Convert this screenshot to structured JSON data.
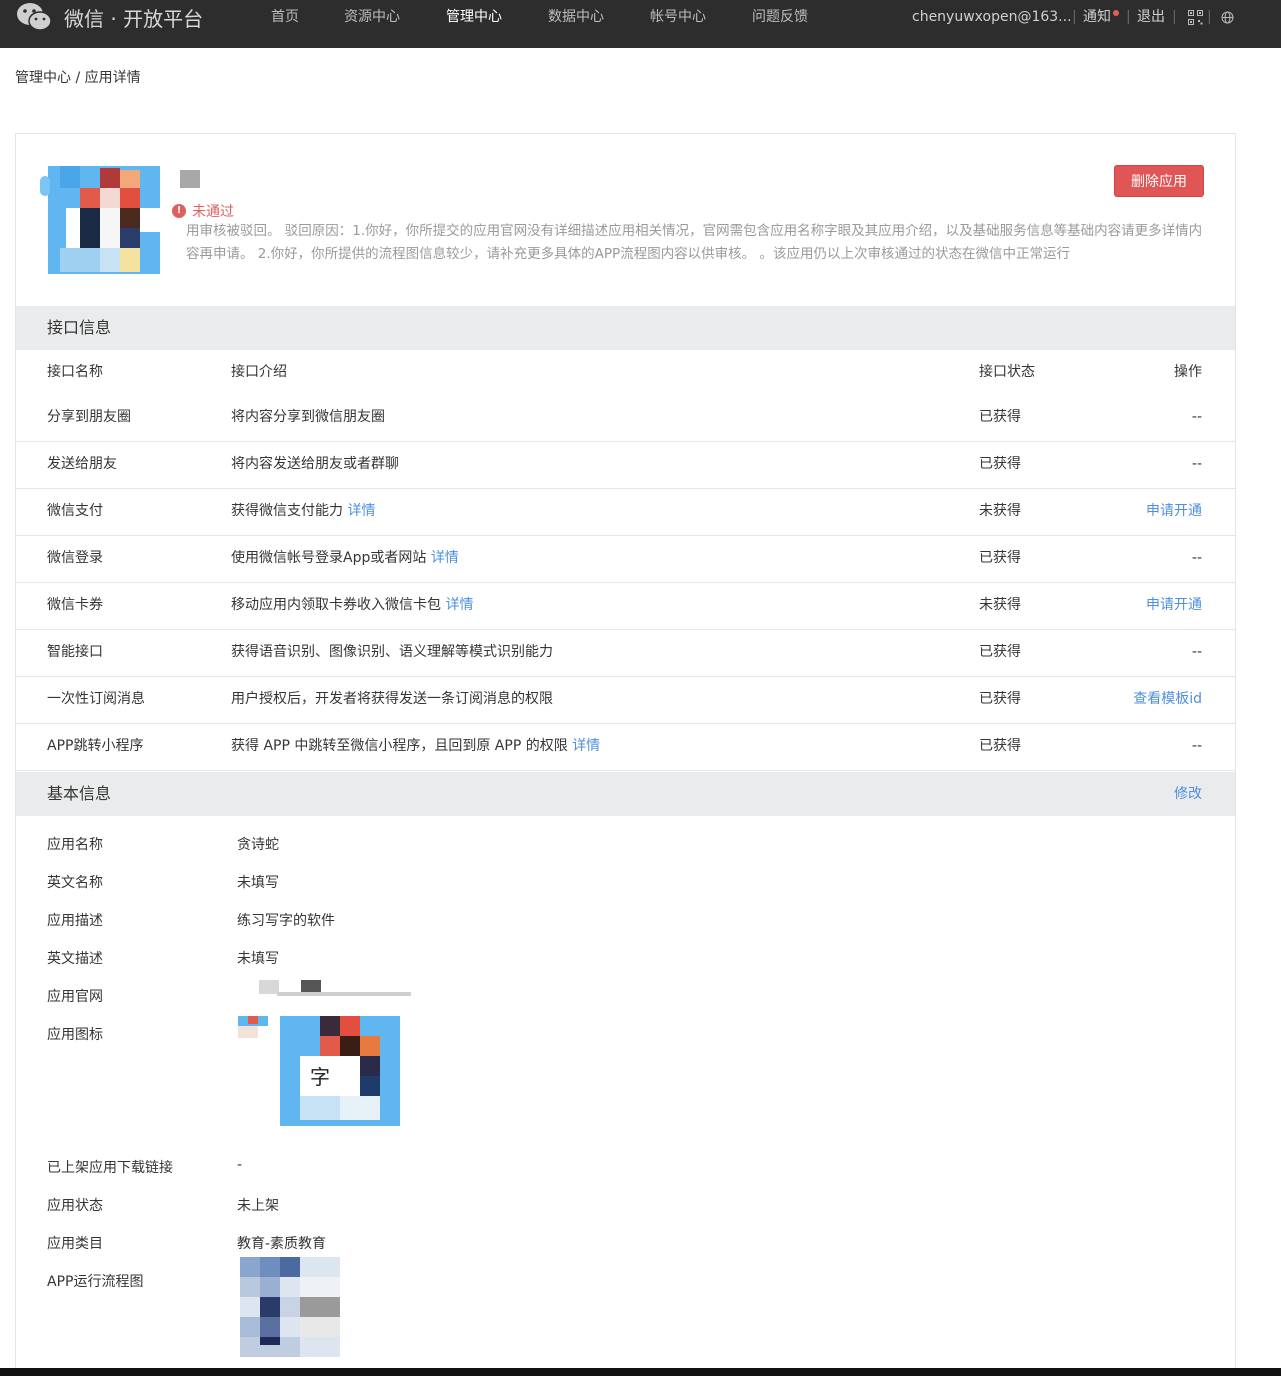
{
  "topbar": {
    "brand": "微信 · 开放平台",
    "nav": [
      "首页",
      "资源中心",
      "管理中心",
      "数据中心",
      "帐号中心",
      "问题反馈"
    ],
    "active_nav": "管理中心",
    "user": "chenyuwxopen@163...",
    "notify": "通知",
    "logout": "退出"
  },
  "breadcrumb": "管理中心 / 应用详情",
  "app": {
    "status": "未通过",
    "reject_reason": "用审核被驳回。 驳回原因：1.你好，你所提交的应用官网没有详细描述应用相关情况，官网需包含应用名称字眼及其应用介绍，以及基础服务信息等基础内容请更多详情内容再申请。 2.你好，你所提供的流程图信息较少，请补充更多具体的APP流程图内容以供审核。 。该应用仍以上次审核通过的状态在微信中正常运行",
    "delete_label": "删除应用"
  },
  "api_section": {
    "title": "接口信息",
    "headers": [
      "接口名称",
      "接口介绍",
      "接口状态",
      "操作"
    ],
    "rows": [
      {
        "name": "分享到朋友圈",
        "desc": "将内容分享到微信朋友圈",
        "link": "",
        "status": "已获得",
        "action": "--",
        "action_link": false
      },
      {
        "name": "发送给朋友",
        "desc": "将内容发送给朋友或者群聊",
        "link": "",
        "status": "已获得",
        "action": "--",
        "action_link": false
      },
      {
        "name": "微信支付",
        "desc": "获得微信支付能力",
        "link": "详情",
        "status": "未获得",
        "action": "申请开通",
        "action_link": true
      },
      {
        "name": "微信登录",
        "desc": "使用微信帐号登录App或者网站",
        "link": "详情",
        "status": "已获得",
        "action": "--",
        "action_link": false
      },
      {
        "name": "微信卡券",
        "desc": "移动应用内领取卡券收入微信卡包",
        "link": "详情",
        "status": "未获得",
        "action": "申请开通",
        "action_link": true
      },
      {
        "name": "智能接口",
        "desc": "获得语音识别、图像识别、语义理解等模式识别能力",
        "link": "",
        "status": "已获得",
        "action": "--",
        "action_link": false
      },
      {
        "name": "一次性订阅消息",
        "desc": "用户授权后，开发者将获得发送一条订阅消息的权限",
        "link": "",
        "status": "已获得",
        "action": "查看模板id",
        "action_link": true
      },
      {
        "name": "APP跳转小程序",
        "desc": "获得 APP 中跳转至微信小程序，且回到原 APP 的权限",
        "link": "详情",
        "status": "已获得",
        "action": "--",
        "action_link": false
      }
    ]
  },
  "basic_section": {
    "title": "基本信息",
    "edit_label": "修改",
    "fields": {
      "name_k": "应用名称",
      "name_v": "贪诗蛇",
      "en_name_k": "英文名称",
      "en_name_v": "未填写",
      "desc_k": "应用描述",
      "desc_v": "练习写字的软件",
      "en_desc_k": "英文描述",
      "en_desc_v": "未填写",
      "site_k": "应用官网",
      "icon_k": "应用图标",
      "download_k": "已上架应用下载链接",
      "download_v": "-",
      "state_k": "应用状态",
      "state_v": "未上架",
      "category_k": "应用类目",
      "category_v": "教育-素质教育",
      "flow_k": "APP运行流程图"
    }
  },
  "colors": {
    "accent": "#4e8fe0",
    "danger": "#e05555",
    "topbar": "#2d2d2d"
  }
}
